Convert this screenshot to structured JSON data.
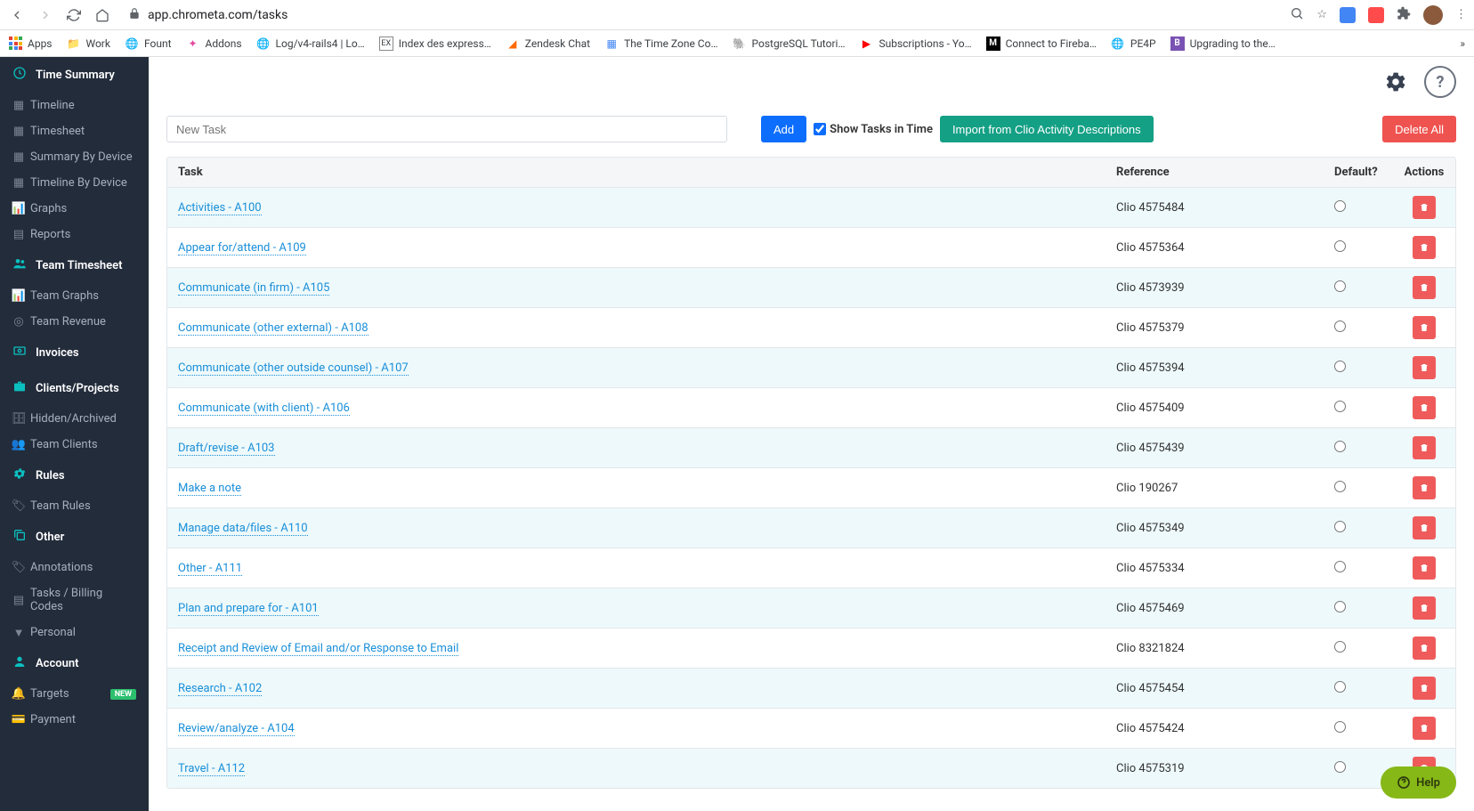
{
  "browser": {
    "url": "app.chrometa.com/tasks",
    "bookmarks": [
      {
        "label": "Apps",
        "type": "apps"
      },
      {
        "label": "Work",
        "type": "folder"
      },
      {
        "label": "Fount",
        "type": "globe"
      },
      {
        "label": "Addons",
        "type": "addons"
      },
      {
        "label": "Log/v4-rails4 | Lo…",
        "type": "globe"
      },
      {
        "label": "Index des express…",
        "type": "ex"
      },
      {
        "label": "Zendesk Chat",
        "type": "zendesk"
      },
      {
        "label": "The Time Zone Co…",
        "type": "doc"
      },
      {
        "label": "PostgreSQL Tutori…",
        "type": "pg"
      },
      {
        "label": "Subscriptions - Yo…",
        "type": "yt"
      },
      {
        "label": "Connect to Fireba…",
        "type": "medium"
      },
      {
        "label": "PE4P",
        "type": "globe"
      },
      {
        "label": "Upgrading to the…",
        "type": "bs"
      }
    ]
  },
  "sidebar": {
    "sections": [
      {
        "label": "Time Summary",
        "icon": "clock",
        "items": [
          {
            "label": "Timeline",
            "icon": "calendar"
          },
          {
            "label": "Timesheet",
            "icon": "calendar"
          },
          {
            "label": "Summary By Device",
            "icon": "calendar"
          },
          {
            "label": "Timeline By Device",
            "icon": "calendar"
          },
          {
            "label": "Graphs",
            "icon": "chart"
          },
          {
            "label": "Reports",
            "icon": "grid"
          }
        ]
      },
      {
        "label": "Team Timesheet",
        "icon": "users",
        "items": [
          {
            "label": "Team Graphs",
            "icon": "chart"
          },
          {
            "label": "Team Revenue",
            "icon": "money"
          }
        ]
      },
      {
        "label": "Invoices",
        "icon": "invoice",
        "items": []
      },
      {
        "label": "Clients/Projects",
        "icon": "briefcase",
        "items": [
          {
            "label": "Hidden/Archived",
            "icon": "archive"
          },
          {
            "label": "Team Clients",
            "icon": "users"
          }
        ]
      },
      {
        "label": "Rules",
        "icon": "gear",
        "items": [
          {
            "label": "Team Rules",
            "icon": "tag"
          }
        ]
      },
      {
        "label": "Other",
        "icon": "copy",
        "items": [
          {
            "label": "Annotations",
            "icon": "tag"
          },
          {
            "label": "Tasks / Billing Codes",
            "icon": "list"
          },
          {
            "label": "Personal",
            "icon": "filter"
          }
        ]
      },
      {
        "label": "Account",
        "icon": "user",
        "items": [
          {
            "label": "Targets",
            "icon": "bell",
            "badge": "NEW"
          },
          {
            "label": "Payment",
            "icon": "card"
          }
        ]
      }
    ]
  },
  "toolbar": {
    "new_task_placeholder": "New Task",
    "add_label": "Add",
    "show_tasks_label": "Show Tasks in Time",
    "import_label": "Import from Clio Activity Descriptions",
    "delete_all_label": "Delete All"
  },
  "table": {
    "headers": {
      "task": "Task",
      "reference": "Reference",
      "default": "Default?",
      "actions": "Actions"
    },
    "rows": [
      {
        "task": "Activities - A100",
        "reference": "Clio 4575484"
      },
      {
        "task": "Appear for/attend - A109",
        "reference": "Clio 4575364"
      },
      {
        "task": "Communicate (in firm) - A105",
        "reference": "Clio 4573939"
      },
      {
        "task": "Communicate (other external) - A108",
        "reference": "Clio 4575379"
      },
      {
        "task": "Communicate (other outside counsel) - A107",
        "reference": "Clio 4575394"
      },
      {
        "task": "Communicate (with client) - A106",
        "reference": "Clio 4575409"
      },
      {
        "task": "Draft/revise - A103",
        "reference": "Clio 4575439"
      },
      {
        "task": "Make a note",
        "reference": "Clio 190267"
      },
      {
        "task": "Manage data/files - A110",
        "reference": "Clio 4575349"
      },
      {
        "task": "Other - A111",
        "reference": "Clio 4575334"
      },
      {
        "task": "Plan and prepare for - A101",
        "reference": "Clio 4575469"
      },
      {
        "task": "Receipt and Review of Email and/or Response to Email",
        "reference": "Clio 8321824"
      },
      {
        "task": "Research - A102",
        "reference": "Clio 4575454"
      },
      {
        "task": "Review/analyze - A104",
        "reference": "Clio 4575424"
      },
      {
        "task": "Travel - A112",
        "reference": "Clio 4575319"
      }
    ]
  },
  "help_fab": "Help"
}
